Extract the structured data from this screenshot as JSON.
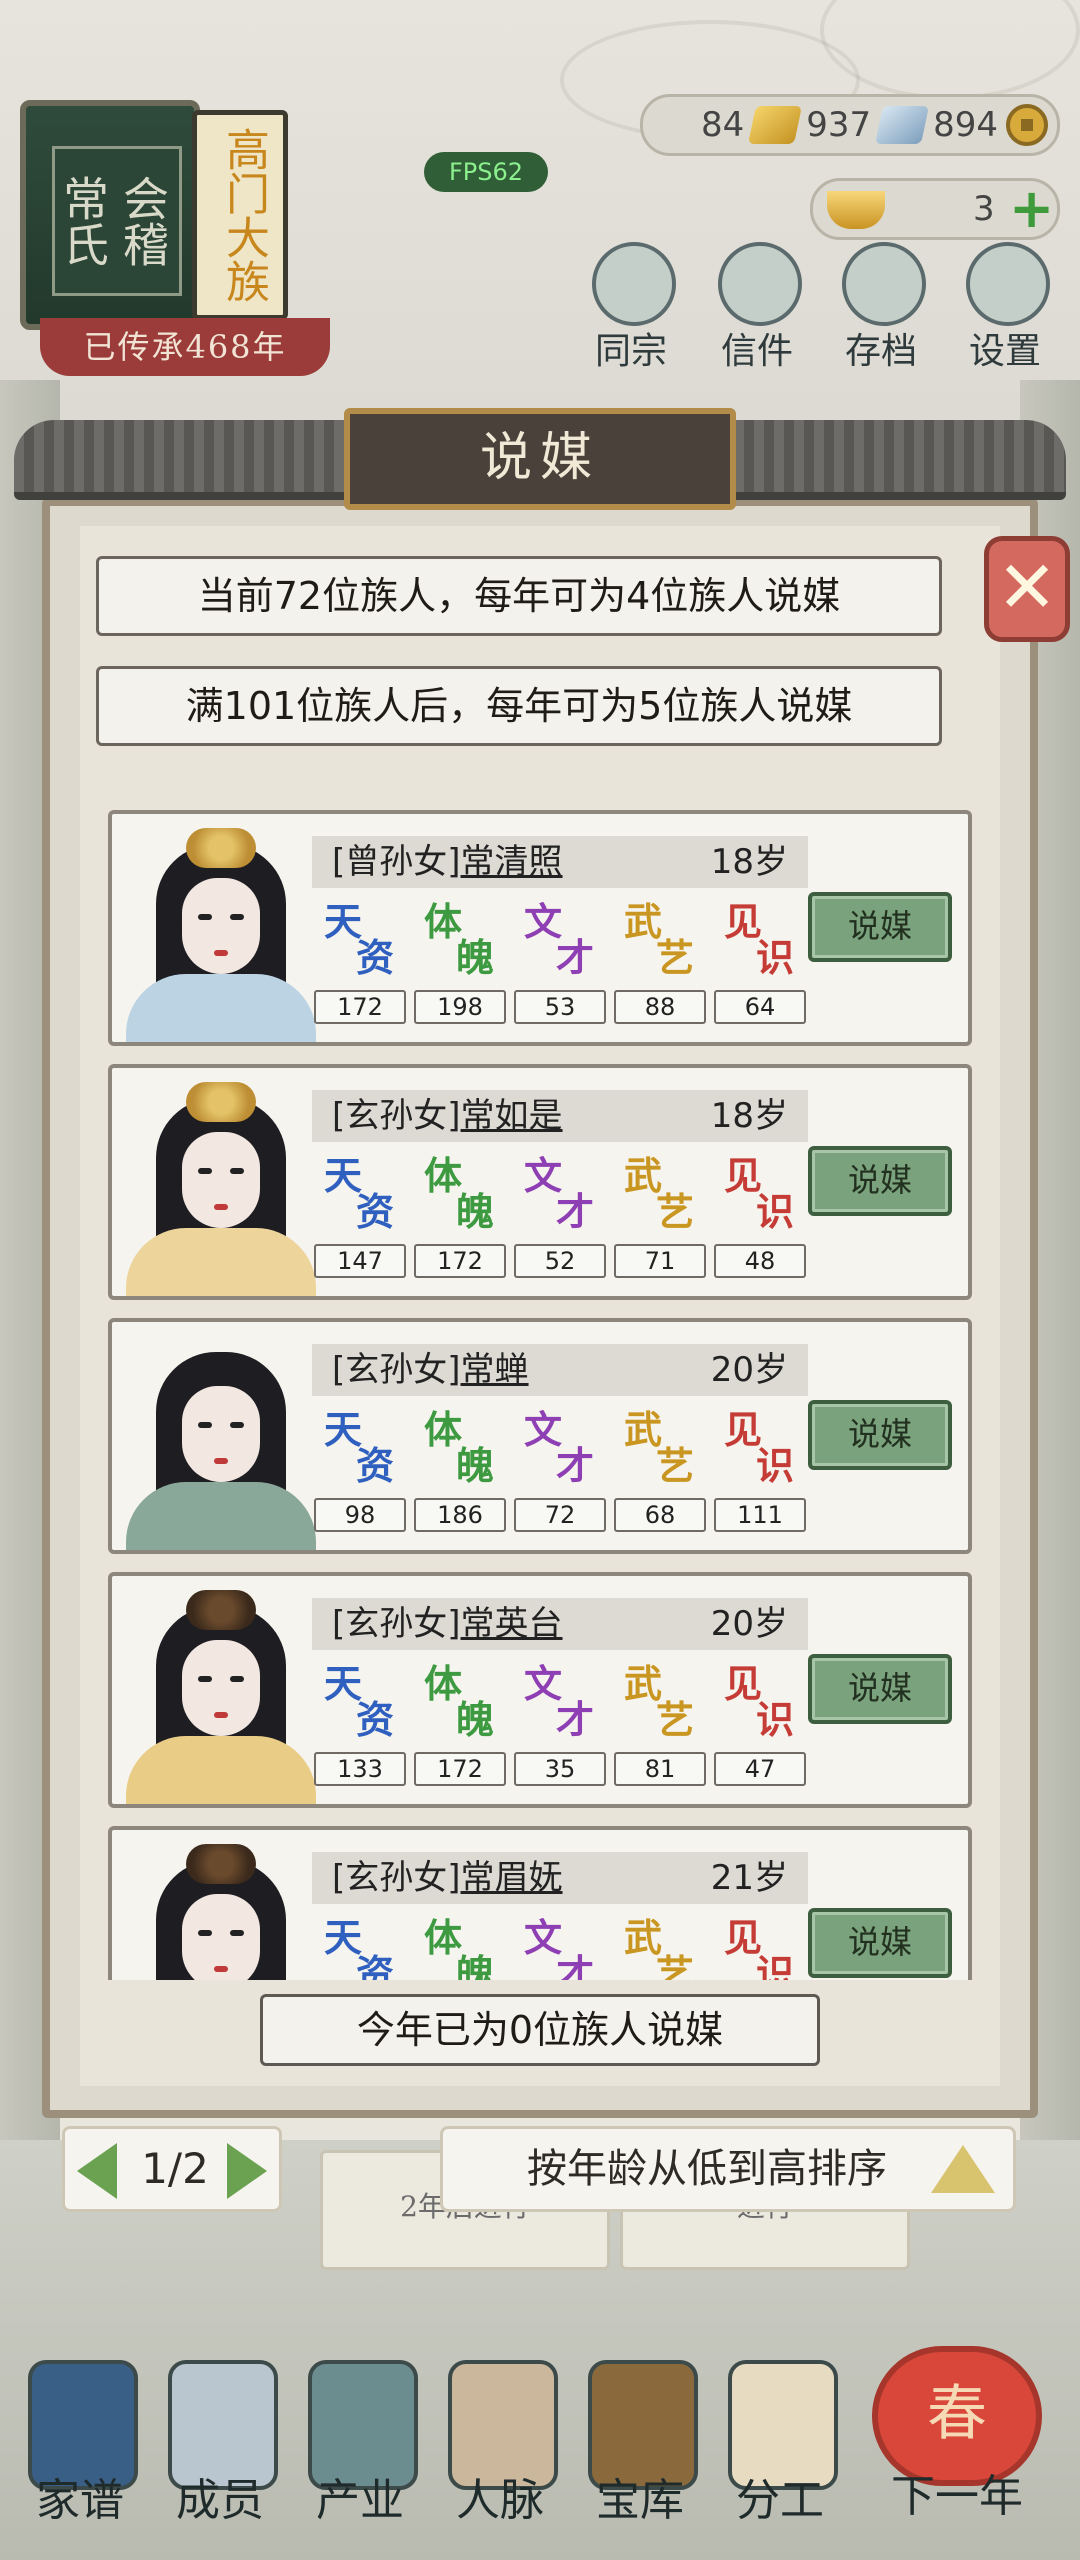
{
  "header": {
    "clan_name": "会稽常氏",
    "clan_rank": "高门大族",
    "inherit_text": "已传承468年",
    "fps": "FPS62",
    "resources": {
      "gold": "84",
      "silver": "937",
      "copper": "894",
      "ingot": "3"
    },
    "top_buttons": [
      "同宗",
      "信件",
      "存档",
      "设置"
    ]
  },
  "dialog": {
    "title": "说媒",
    "info_current": "当前72位族人，每年可为4位族人说媒",
    "info_next": "满101位族人后，每年可为5位族人说媒",
    "stat_labels": {
      "tianzi": [
        "天",
        "资"
      ],
      "tipo": [
        "体",
        "魄"
      ],
      "wencai": [
        "文",
        "才"
      ],
      "wuyi": [
        "武",
        "艺"
      ],
      "jianshi": [
        "见",
        "识"
      ]
    },
    "match_label": "说媒",
    "members": [
      {
        "relation": "[曾孙女]",
        "name": "常清照",
        "age": "18岁",
        "stats": [
          "172",
          "198",
          "53",
          "88",
          "64"
        ]
      },
      {
        "relation": "[玄孙女]",
        "name": "常如是",
        "age": "18岁",
        "stats": [
          "147",
          "172",
          "52",
          "71",
          "48"
        ]
      },
      {
        "relation": "[玄孙女]",
        "name": "常蝉",
        "age": "20岁",
        "stats": [
          "98",
          "186",
          "72",
          "68",
          "111"
        ]
      },
      {
        "relation": "[玄孙女]",
        "name": "常英台",
        "age": "20岁",
        "stats": [
          "133",
          "172",
          "35",
          "81",
          "47"
        ]
      },
      {
        "relation": "[玄孙女]",
        "name": "常眉妩",
        "age": "21岁",
        "stats": [
          "",
          "",
          "",
          "",
          ""
        ]
      }
    ],
    "year_status": "今年已为0位族人说媒"
  },
  "footer": {
    "page": "1/2",
    "sort_label": "按年龄从低到高排序"
  },
  "background_cards": [
    "2年后进行",
    "进行",
    "年后进行"
  ],
  "nav": [
    "家谱",
    "成员",
    "产业",
    "人脉",
    "宝库",
    "分工"
  ],
  "next_year": {
    "lantern": "春",
    "label": "下一年"
  }
}
